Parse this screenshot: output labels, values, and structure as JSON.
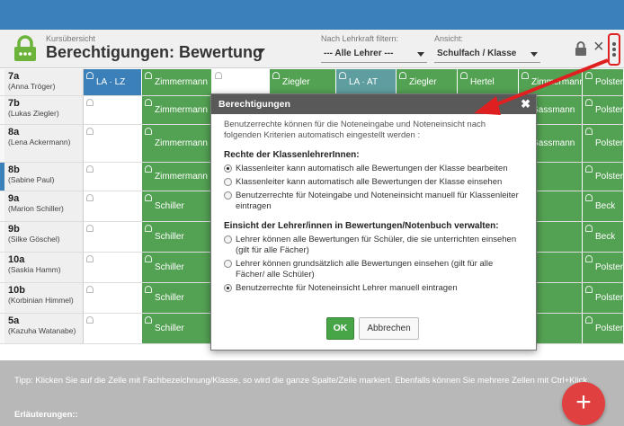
{
  "header": {
    "breadcrumb": "Kursübersicht",
    "title": "Berechtigungen: Bewertung",
    "filter_label": "Nach Lehrkraft filtern:",
    "filter_value": "--- Alle Lehrer ---",
    "view_label": "Ansicht:",
    "view_value": "Schulfach / Klasse"
  },
  "rows": [
    {
      "cls": "7a",
      "teacher": "(Anna Tröger)",
      "cells": [
        "LA · LZ",
        "Zimmermann",
        "",
        "Ziegler",
        "LA · AT",
        "Ziegler",
        "Hertel",
        "Zimmermann",
        "Polster"
      ]
    },
    {
      "cls": "7b",
      "teacher": "(Lukas Ziegler)",
      "cells": [
        "",
        "Zimmermann",
        "",
        "",
        "",
        "",
        "",
        "Gassmann",
        "Polster"
      ]
    },
    {
      "cls": "8a",
      "teacher": "(Lena Ackermann)",
      "cells": [
        "",
        "Zimmermann",
        "",
        "",
        "",
        "",
        "",
        "Gassmann",
        "Polster"
      ]
    },
    {
      "cls": "8b",
      "teacher": "(Sabine Paul)",
      "cells": [
        "",
        "Zimmermann",
        "",
        "",
        "",
        "",
        "",
        "",
        "Polster"
      ]
    },
    {
      "cls": "9a",
      "teacher": "(Marion Schiller)",
      "cells": [
        "",
        "Schiller",
        "",
        "",
        "",
        "",
        "",
        "",
        "Beck"
      ]
    },
    {
      "cls": "9b",
      "teacher": "(Silke Göschel)",
      "cells": [
        "",
        "Schiller",
        "",
        "",
        "",
        "",
        "",
        "",
        "Beck"
      ]
    },
    {
      "cls": "10a",
      "teacher": "(Saskia Hamm)",
      "cells": [
        "",
        "Schiller",
        "",
        "",
        "",
        "",
        "",
        "",
        "Polster"
      ]
    },
    {
      "cls": "10b",
      "teacher": "(Korbinian Himmel)",
      "cells": [
        "",
        "Schiller",
        "",
        "",
        "",
        "",
        "",
        "",
        "Polster"
      ]
    },
    {
      "cls": "5a",
      "teacher": "(Kazuha Watanabe)",
      "cells": [
        "",
        "Schiller",
        "",
        "",
        "",
        "",
        "",
        "",
        "Polster"
      ]
    }
  ],
  "footer": {
    "tip": "Tipp: Klicken Sie auf die Zelle mit Fachbezeichnung/Klasse, so wird die ganze Spalte/Zeile markiert. Ebenfalls können Sie mehrere Zellen mit Ctrl+Klick",
    "erlaeuterungen": "Erläuterungen::"
  },
  "dialog": {
    "title": "Berechtigungen",
    "intro": "Benutzerrechte können für die Noteneingabe und Noteneinsicht nach folgenden Kriterien automatisch eingestellt werden :",
    "section1": "Rechte der KlassenlehrerInnen:",
    "options1": [
      {
        "label": "Klassenleiter kann automatisch alle Bewertungen der Klasse bearbeiten",
        "checked": true
      },
      {
        "label": "Klassenleiter kann automatisch alle Bewertungen der Klasse einsehen",
        "checked": false
      },
      {
        "label": "Benutzerrechte für Noteingabe und Noteneinsicht manuell für Klassenleiter eintragen",
        "checked": false
      }
    ],
    "section2": "Einsicht der Lehrer/innen in Bewertungen/Notenbuch verwalten:",
    "options2": [
      {
        "label": "Lehrer können alle Bewertungen für Schüler, die sie unterrichten einsehen (gilt für alle Fächer)",
        "checked": false
      },
      {
        "label": "Lehrer können grundsätzlich alle Bewertungen einsehen (gilt für alle Fächer/ alle Schüler)",
        "checked": false
      },
      {
        "label": "Benutzerrechte für Noteneinsicht Lehrer manuell eintragen",
        "checked": true
      }
    ],
    "ok": "OK",
    "cancel": "Abbrechen"
  },
  "fab_label": "+",
  "colors": {
    "green": "#53a153",
    "blue": "#3b80b8",
    "dialog_header": "#595959",
    "arrow": "#e02020"
  }
}
